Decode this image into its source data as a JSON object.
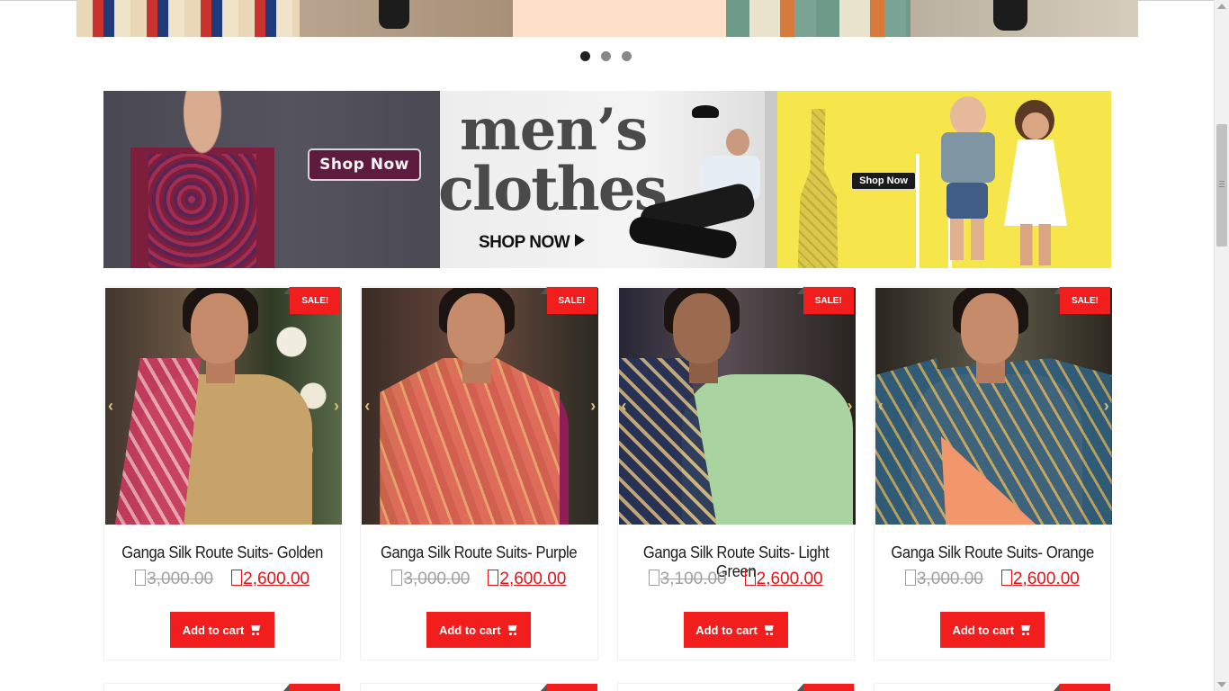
{
  "slider": {
    "dots": [
      {
        "label": "",
        "active": true
      },
      {
        "label": "",
        "active": false
      },
      {
        "label": "",
        "active": false
      }
    ]
  },
  "banners": [
    {
      "name": "women-ethnic-banner",
      "button_label": "Shop Now"
    },
    {
      "name": "mens-clothes-banner",
      "headline_line1": "men’s",
      "headline_line2": "clothes",
      "button_label": "SHOP NOW"
    },
    {
      "name": "kids-banner",
      "button_label": "Shop Now"
    }
  ],
  "products": [
    {
      "title": "Ganga Silk Route Suits- Golden",
      "badge": "SALE!",
      "old_price": "3,000.00",
      "new_price": "2,600.00",
      "cart_label": "Add to cart"
    },
    {
      "title": "Ganga Silk Route Suits- Purple",
      "badge": "SALE!",
      "old_price": "3,000.00",
      "new_price": "2,600.00",
      "cart_label": "Add to cart"
    },
    {
      "title": "Ganga Silk Route Suits- Light Green",
      "badge": "SALE!",
      "old_price": "3,100.00",
      "new_price": "2,600.00",
      "cart_label": "Add to cart"
    },
    {
      "title": "Ganga Silk Route Suits- Orange",
      "badge": "SALE!",
      "old_price": "3,000.00",
      "new_price": "2,600.00",
      "cart_label": "Add to cart"
    }
  ],
  "colors": {
    "accent_red": "#f21d1d",
    "price_red": "#e0151a",
    "old_price_gray": "#a0a0a0",
    "kids_banner_yellow": "#f6e64c"
  },
  "icons": {
    "cart": "shopping-cart-icon",
    "prev": "chevron-left-icon",
    "next": "chevron-right-icon",
    "currency": "rupee-symbol-placeholder"
  }
}
